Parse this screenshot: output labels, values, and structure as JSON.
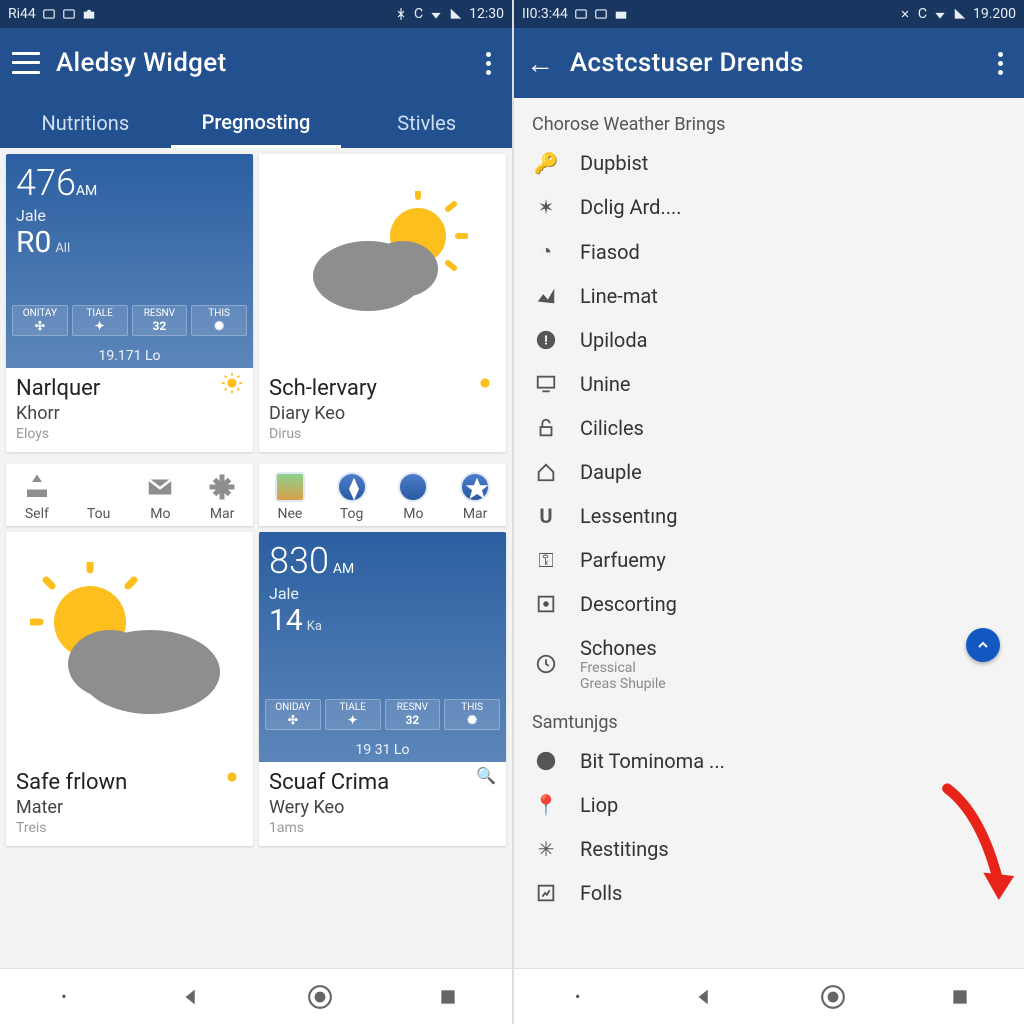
{
  "left": {
    "status": {
      "left": "Ri44",
      "time": "12:30"
    },
    "appbar": {
      "title": "Aledsy Widget"
    },
    "tabs": [
      {
        "label": "Nutritions",
        "active": false
      },
      {
        "label": "Pregnosting",
        "active": true
      },
      {
        "label": "Stivles",
        "active": false
      }
    ],
    "card1": {
      "time": "476",
      "am": "AM",
      "loc": "Jale",
      "temp": "R0",
      "temp_sub": "All",
      "days": [
        "ONITAY",
        "TIALE",
        "RESNV",
        "THIS"
      ],
      "foot": "19.171 Lo",
      "title": "Narlquer",
      "line2": "Khorr",
      "line3": "Eloys"
    },
    "card2": {
      "title": "Sch-lervary",
      "line2": "Diary Keo",
      "line3": "Dirus"
    },
    "iconrow1": [
      "Self",
      "Tou",
      "Mo",
      "Mar"
    ],
    "iconrow2": [
      "Nee",
      "Tog",
      "Mo",
      "Mar"
    ],
    "card3": {
      "title": "Safe frlown",
      "line2": "Mater",
      "line3": "Treis"
    },
    "card4": {
      "time": "830",
      "am": "AM",
      "loc": "Jale",
      "temp": "14",
      "temp_sub": "Ka",
      "days": [
        "ONIDAY",
        "TIALE",
        "RESNV",
        "THIS"
      ],
      "foot": "19 31 Lo",
      "title": "Scuaf Crima",
      "line2": "Wery Keo",
      "line3": "1ams"
    }
  },
  "right": {
    "status": {
      "left": "II0:3:44",
      "time": "19.200"
    },
    "appbar": {
      "title": "Acstcstuser Drends"
    },
    "section1": "Chorose Weather Brings",
    "items1": [
      {
        "icon": "key",
        "label": "Dupbist"
      },
      {
        "icon": "person",
        "label": "Dclig Ard...."
      },
      {
        "icon": "circle-dot",
        "label": "Fiasod"
      },
      {
        "icon": "chart",
        "label": "Line-mat"
      },
      {
        "icon": "info",
        "label": "Upiloda"
      },
      {
        "icon": "monitor",
        "label": "Unine"
      },
      {
        "icon": "lock",
        "label": "Cilicles"
      },
      {
        "icon": "home",
        "label": "Dauple"
      },
      {
        "icon": "u",
        "label": "Lessentıng"
      },
      {
        "icon": "key2",
        "label": "Parfuemy"
      },
      {
        "icon": "square-dot",
        "label": "Descorting"
      },
      {
        "icon": "clock",
        "label": "Schones",
        "sub1": "Fressical",
        "sub2": "Greas Shupile"
      }
    ],
    "section2": "Samtunjgs",
    "items2": [
      {
        "icon": "info",
        "label": "Bit Tominoma ..."
      },
      {
        "icon": "pin",
        "label": "Liop"
      },
      {
        "icon": "asterisk",
        "label": "Restitings"
      },
      {
        "icon": "box",
        "label": "Folls"
      }
    ]
  }
}
